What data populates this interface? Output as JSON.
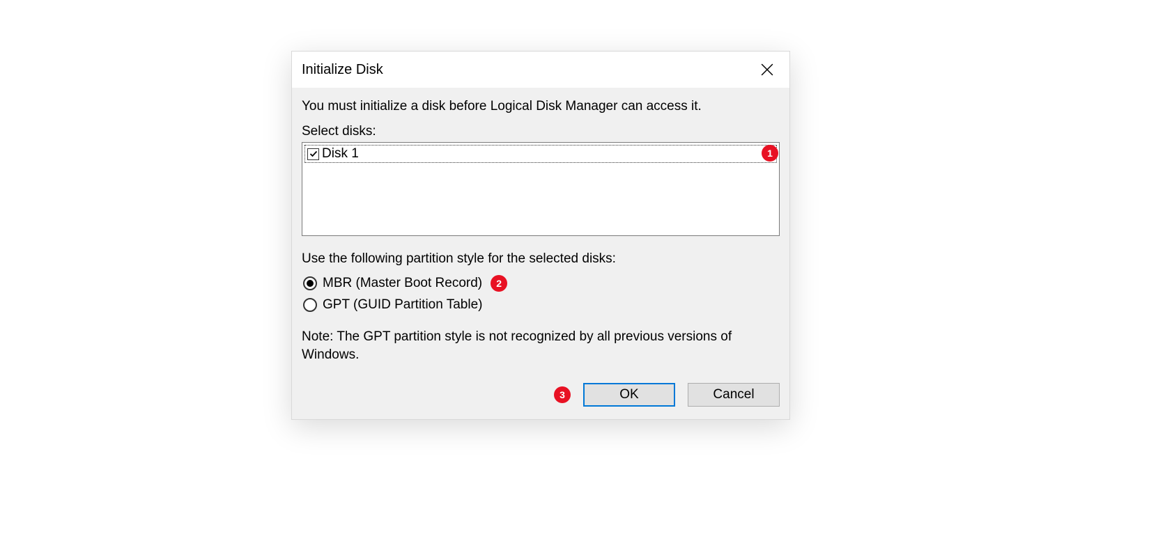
{
  "dialog": {
    "title": "Initialize Disk",
    "instruction": "You must initialize a disk before Logical Disk Manager can access it.",
    "select_label": "Select disks:",
    "disks": [
      {
        "label": "Disk 1",
        "checked": true
      }
    ],
    "partition_label": "Use the following partition style for the selected disks:",
    "radios": [
      {
        "label": "MBR (Master Boot Record)",
        "selected": true
      },
      {
        "label": "GPT (GUID Partition Table)",
        "selected": false
      }
    ],
    "note": "Note: The GPT partition style is not recognized by all previous versions of Windows.",
    "ok_label": "OK",
    "cancel_label": "Cancel"
  },
  "annotations": {
    "a1": "1",
    "a2": "2",
    "a3": "3"
  }
}
